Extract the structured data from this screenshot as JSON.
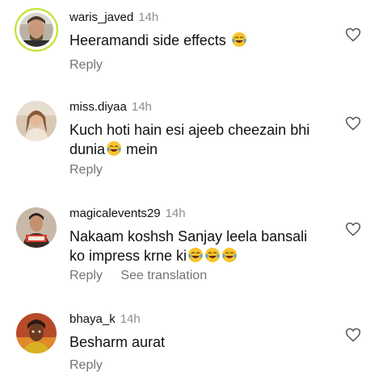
{
  "comments": [
    {
      "username": "waris_javed",
      "time": "14h",
      "text_lines": [
        "Heeramandi side effects"
      ],
      "emoji_counts": [
        1
      ],
      "reply_label": "Reply",
      "see_translation": ""
    },
    {
      "username": "miss.diyaa",
      "time": "14h",
      "text_lines": [
        "Kuch hoti hain esi ajeeb cheezain bhi",
        "dunia",
        " mein"
      ],
      "emoji_counts": [
        0,
        1,
        0
      ],
      "reply_label": "Reply",
      "see_translation": ""
    },
    {
      "username": "magicalevents29",
      "time": "14h",
      "text_lines": [
        "Nakaam koshsh Sanjay leela bansali",
        "ko impress krne ki"
      ],
      "emoji_counts": [
        0,
        3
      ],
      "reply_label": "Reply",
      "see_translation": "See translation"
    },
    {
      "username": "bhaya_k",
      "time": "14h",
      "text_lines": [
        "Besharm aurat"
      ],
      "emoji_counts": [
        0
      ],
      "reply_label": "Reply",
      "see_translation": ""
    }
  ],
  "icons": {
    "like": "heart-outline-icon",
    "emoji": "face-with-tears-of-joy-icon"
  },
  "colors": {
    "text": "#111111",
    "muted": "#8e8e8e",
    "action": "#737373",
    "story_ring": "#c1e232"
  }
}
